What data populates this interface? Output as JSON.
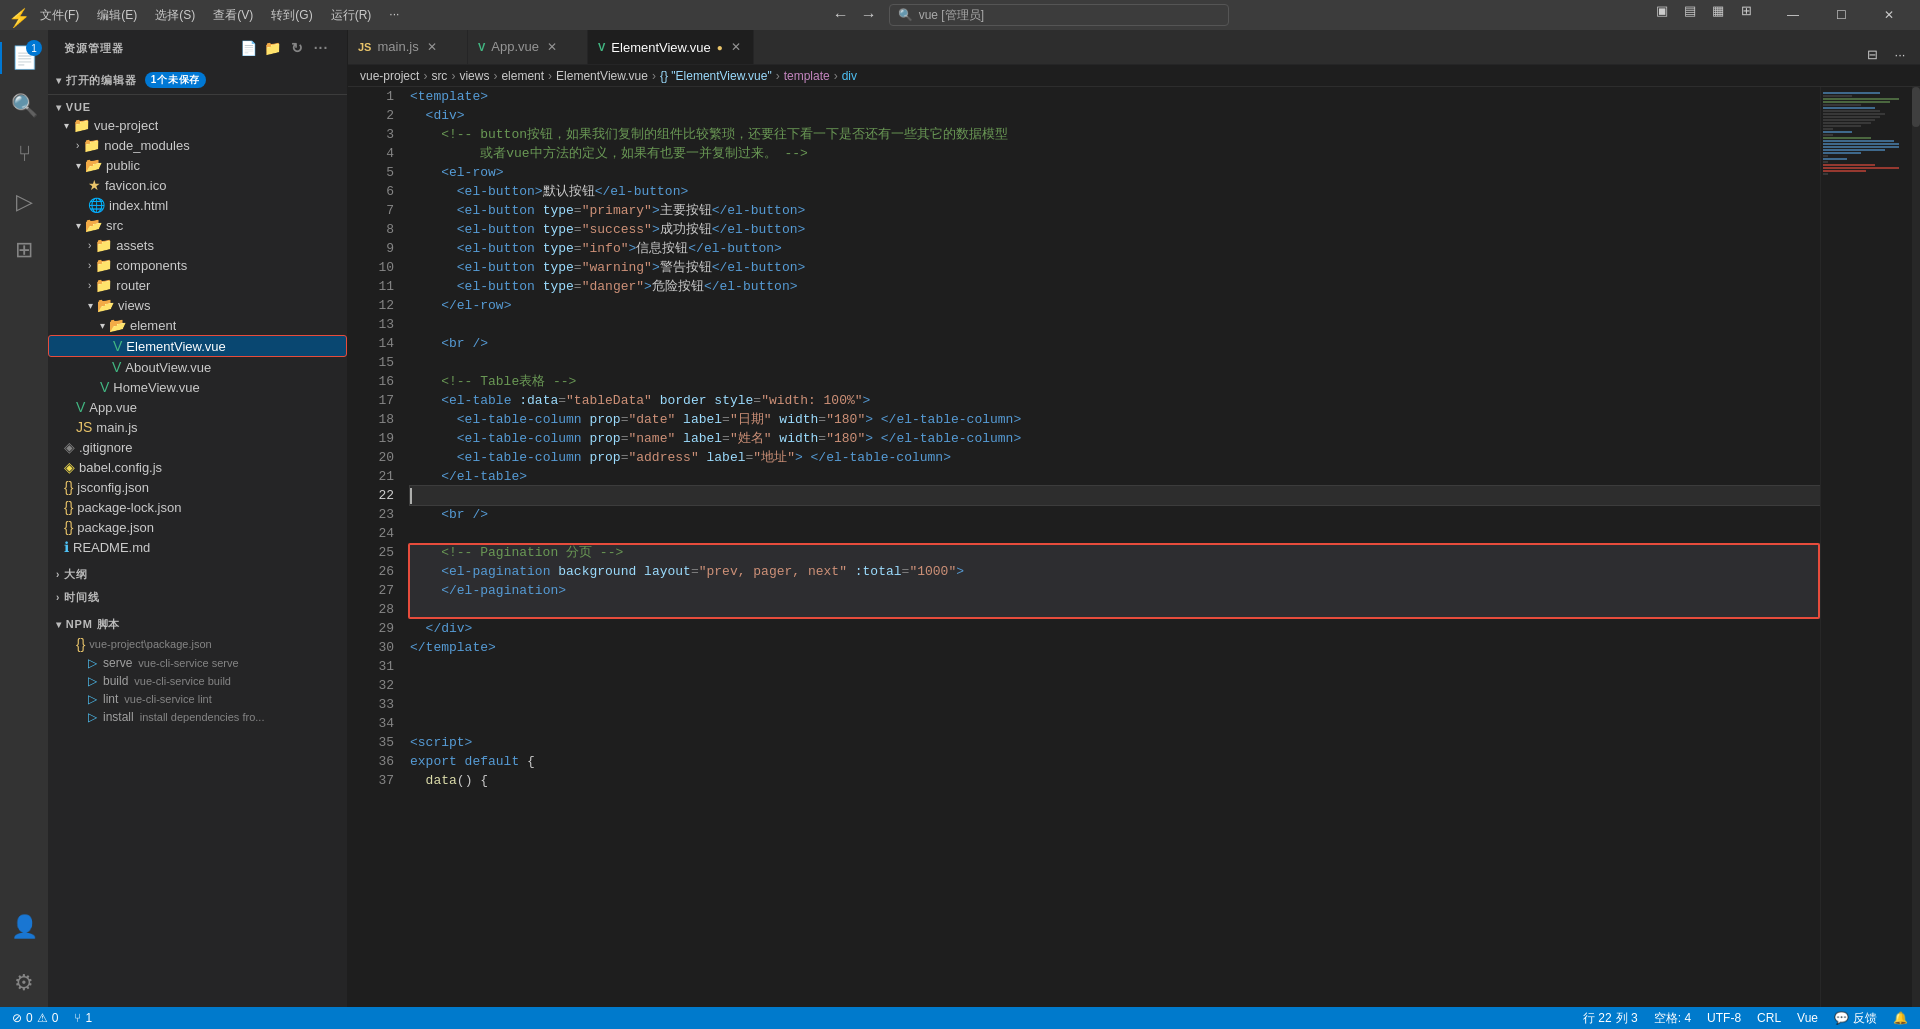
{
  "titlebar": {
    "app_icon": "⚡",
    "menu_items": [
      "文件(F)",
      "编辑(E)",
      "选择(S)",
      "查看(V)",
      "转到(G)",
      "运行(R)",
      "···"
    ],
    "search_placeholder": "vue [管理员]",
    "back_btn": "←",
    "forward_btn": "→",
    "layout_btns": [
      "▣",
      "▤",
      "▦",
      "⊞"
    ],
    "window_btns": [
      "—",
      "☐",
      "✕"
    ]
  },
  "sidebar": {
    "title": "资源管理器",
    "more_btn": "···",
    "open_editors_label": "打开的编辑器",
    "unsaved_badge": "1个未保存",
    "vue_section_label": "VUE",
    "vue_project": {
      "label": "vue-project",
      "children": {
        "node_modules": "node_modules",
        "public": {
          "label": "public",
          "children": {
            "favicon": "favicon.ico",
            "index": "index.html"
          }
        },
        "src": {
          "label": "src",
          "children": {
            "assets": "assets",
            "components": "components",
            "router": "router",
            "views": {
              "label": "views",
              "children": {
                "element": {
                  "label": "element",
                  "children": {
                    "ElementView": "ElementView.vue",
                    "AboutView": "AboutView.vue"
                  }
                },
                "HomeView": "HomeView.vue"
              }
            }
          }
        },
        "App": "App.vue",
        "main": "main.js"
      }
    },
    "gitignore": ".gitignore",
    "babel_config": "babel.config.js",
    "jsconfig": "jsconfig.json",
    "package_lock": "package-lock.json",
    "package": "package.json",
    "readme": "README.md",
    "outline_label": "大纲",
    "timeline_label": "时间线",
    "npm_section_label": "NPM 脚本",
    "npm_items": [
      {
        "label": "vue-project\\package.json"
      },
      {
        "cmd": "serve",
        "script": "vue-cli-service serve"
      },
      {
        "cmd": "build",
        "script": "vue-cli-service build"
      },
      {
        "cmd": "lint",
        "script": "vue-cli-service lint"
      },
      {
        "cmd": "install",
        "script": "install dependencies fro..."
      }
    ]
  },
  "tabs": [
    {
      "label": "main.js",
      "type": "js",
      "active": false
    },
    {
      "label": "App.vue",
      "type": "vue",
      "active": false
    },
    {
      "label": "ElementView.vue",
      "type": "vue",
      "active": true,
      "dirty": true
    }
  ],
  "breadcrumb": {
    "items": [
      "vue-project",
      "src",
      "views",
      "element",
      "ElementView.vue",
      "{} \"ElementView.vue\"",
      "template",
      "div"
    ]
  },
  "editor": {
    "current_line": 22,
    "current_col": 3,
    "indent": 4,
    "encoding": "UTF-8",
    "line_ending": "CRL",
    "language": "Vue",
    "lines": [
      {
        "num": 1,
        "content": "<template>",
        "type": "normal"
      },
      {
        "num": 2,
        "content": "  <div>",
        "type": "normal"
      },
      {
        "num": 3,
        "content": "    <!-- button按钮，如果我们复制的组件比较繁琐，还要往下看一下是否还有一些其它的数据模型",
        "type": "comment"
      },
      {
        "num": 4,
        "content": "         或者vue中方法的定义，如果有也要一并复制过来。 -->",
        "type": "comment"
      },
      {
        "num": 5,
        "content": "    <el-row>",
        "type": "normal"
      },
      {
        "num": 6,
        "content": "      <el-button>默认按钮</el-button>",
        "type": "normal"
      },
      {
        "num": 7,
        "content": "      <el-button type=\"primary\">主要按钮</el-button>",
        "type": "normal"
      },
      {
        "num": 8,
        "content": "      <el-button type=\"success\">成功按钮</el-button>",
        "type": "normal"
      },
      {
        "num": 9,
        "content": "      <el-button type=\"info\">信息按钮</el-button>",
        "type": "normal"
      },
      {
        "num": 10,
        "content": "      <el-button type=\"warning\">警告按钮</el-button>",
        "type": "normal"
      },
      {
        "num": 11,
        "content": "      <el-button type=\"danger\">危险按钮</el-button>",
        "type": "normal"
      },
      {
        "num": 12,
        "content": "    </el-row>",
        "type": "normal"
      },
      {
        "num": 13,
        "content": "",
        "type": "normal"
      },
      {
        "num": 14,
        "content": "    <br />",
        "type": "normal"
      },
      {
        "num": 15,
        "content": "",
        "type": "normal"
      },
      {
        "num": 16,
        "content": "    <!-- Table表格 -->",
        "type": "comment"
      },
      {
        "num": 17,
        "content": "    <el-table :data=\"tableData\" border style=\"width: 100%\">",
        "type": "normal"
      },
      {
        "num": 18,
        "content": "      <el-table-column prop=\"date\" label=\"日期\" width=\"180\"> </el-table-column>",
        "type": "normal"
      },
      {
        "num": 19,
        "content": "      <el-table-column prop=\"name\" label=\"姓名\" width=\"180\"> </el-table-column>",
        "type": "normal"
      },
      {
        "num": 20,
        "content": "      <el-table-column prop=\"address\" label=\"地址\"> </el-table-column>",
        "type": "normal"
      },
      {
        "num": 21,
        "content": "    </el-table>",
        "type": "normal"
      },
      {
        "num": 22,
        "content": "",
        "type": "current"
      },
      {
        "num": 23,
        "content": "    <br />",
        "type": "normal"
      },
      {
        "num": 24,
        "content": "",
        "type": "normal"
      },
      {
        "num": 25,
        "content": "    <!-- Pagination 分页 -->",
        "type": "comment",
        "highlight": "box-start"
      },
      {
        "num": 26,
        "content": "    <el-pagination background layout=\"prev, pager, next\" :total=\"1000\">",
        "type": "normal",
        "highlight": "box-mid"
      },
      {
        "num": 27,
        "content": "    </el-pagination>",
        "type": "normal",
        "highlight": "box-mid"
      },
      {
        "num": 28,
        "content": "",
        "type": "normal",
        "highlight": "box-end"
      },
      {
        "num": 29,
        "content": "  </div>",
        "type": "normal"
      },
      {
        "num": 30,
        "content": "</template>",
        "type": "normal"
      },
      {
        "num": 31,
        "content": "",
        "type": "normal"
      },
      {
        "num": 32,
        "content": "",
        "type": "normal"
      },
      {
        "num": 33,
        "content": "",
        "type": "normal"
      },
      {
        "num": 34,
        "content": "",
        "type": "normal"
      },
      {
        "num": 35,
        "content": "<script>",
        "type": "normal"
      },
      {
        "num": 36,
        "content": "export default {",
        "type": "normal"
      },
      {
        "num": 37,
        "content": "  data() {",
        "type": "normal"
      }
    ]
  },
  "status_bar": {
    "errors": "0",
    "warnings": "0",
    "git_branch": "1",
    "line": "行 22",
    "col": "列 3",
    "spaces": "空格: 4",
    "encoding": "UTF-8",
    "line_ending": "CRL",
    "language": "Vue",
    "feedback": "反馈",
    "notifications": "🔔"
  }
}
